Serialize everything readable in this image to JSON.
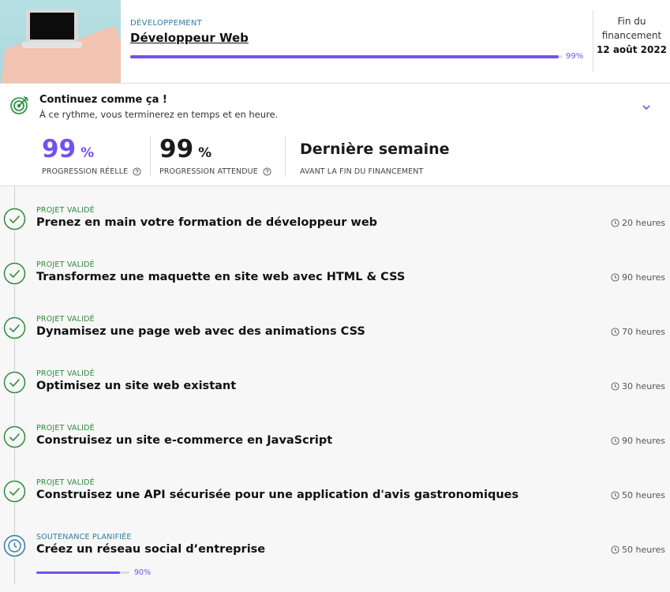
{
  "header": {
    "category": "DÉVELOPPEMENT",
    "title": "Développeur Web",
    "progress": 0.99,
    "progress_label": "99%",
    "end_label_line1": "Fin du",
    "end_label_line2": "financement",
    "end_date": "12 août 2022"
  },
  "status": {
    "title": "Continuez comme ça !",
    "subtitle": "À ce rythme, vous terminerez en temps et en heure.",
    "stats": [
      {
        "value": "99",
        "unit": "%",
        "label": "PROGRESSION RÉELLE"
      },
      {
        "value": "99",
        "unit": "%",
        "label": "PROGRESSION ATTENDUE"
      },
      {
        "value": "Dernière semaine",
        "unit": "",
        "label": "AVANT LA FIN DU FINANCEMENT"
      }
    ]
  },
  "projects": [
    {
      "status": "PROJET VALIDÉ",
      "title": "Prenez en main votre formation de développeur web",
      "hours": "20 heures",
      "state": "validated"
    },
    {
      "status": "PROJET VALIDÉ",
      "title": "Transformez une maquette en site web avec HTML & CSS",
      "hours": "90 heures",
      "state": "validated"
    },
    {
      "status": "PROJET VALIDÉ",
      "title": "Dynamisez une page web avec des animations CSS",
      "hours": "70 heures",
      "state": "validated"
    },
    {
      "status": "PROJET VALIDÉ",
      "title": "Optimisez un site web existant",
      "hours": "30 heures",
      "state": "validated"
    },
    {
      "status": "PROJET VALIDÉ",
      "title": "Construisez un site e-commerce en JavaScript",
      "hours": "90 heures",
      "state": "validated"
    },
    {
      "status": "PROJET VALIDÉ",
      "title": "Construisez une API sécurisée pour une application d'avis gastronomiques",
      "hours": "50 heures",
      "state": "validated"
    },
    {
      "status": "SOUTENANCE PLANIFIÉE",
      "title": "Créez un réseau social d’entreprise",
      "hours": "50 heures",
      "state": "planned",
      "progress": 0.9,
      "progress_label": "90%"
    }
  ],
  "colors": {
    "accent": "#7451eb",
    "validated": "#2e8b3e",
    "planned": "#2b7fa1"
  }
}
